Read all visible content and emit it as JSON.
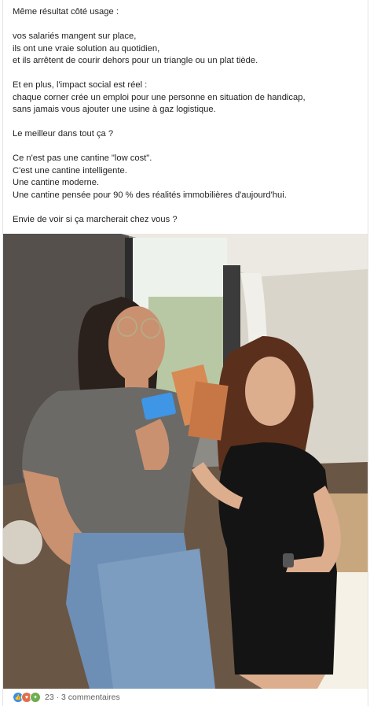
{
  "post": {
    "lines": [
      "Même résultat côté usage :",
      "",
      "vos salariés mangent sur place,",
      "ils ont une vraie solution au quotidien,",
      "et ils arrêtent de courir dehors pour un triangle ou un plat tiède.",
      "",
      "Et en plus, l'impact social est réel :",
      "chaque corner crée un emploi pour une personne en situation de handicap,",
      "sans jamais vous ajouter une usine à gaz logistique.",
      "",
      "Le meilleur dans tout ça ?",
      "",
      "Ce n'est pas une cantine \"low cost\".",
      "C'est une cantine intelligente.",
      "Une cantine moderne.",
      "Une cantine pensée pour 90 % des réalités immobilières d'aujourd'hui.",
      "",
      "Envie de voir si ça marcherait chez vous ?"
    ]
  },
  "social": {
    "reactions": [
      "like-icon",
      "love-icon",
      "celebrate-icon"
    ],
    "summary": "23 · 3 commentaires"
  },
  "colors": {
    "like": "#378fe9",
    "love": "#df704d",
    "celebrate": "#6dae4f"
  }
}
